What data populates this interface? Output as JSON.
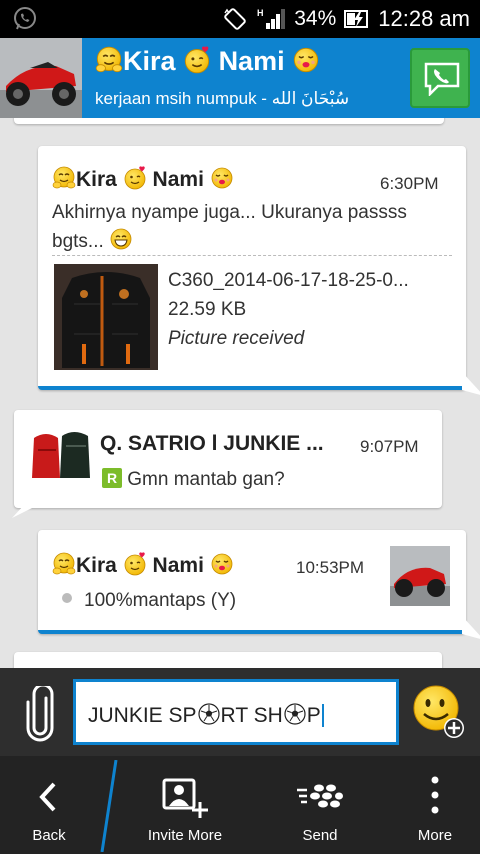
{
  "status_bar": {
    "battery": "34%",
    "time": "12:28 am"
  },
  "header": {
    "title": "Kira",
    "title_name": "Nami",
    "subtitle": "kerjaan msih numpuk  - سُبْحَانَ الله"
  },
  "messages": [
    {
      "sender": "Kira",
      "sender_name": "Nami",
      "time": "6:30PM",
      "text": "Akhirnya nyampe juga... Ukuranya passss bgts...",
      "attachment": {
        "filename": "C360_2014-06-17-18-25-0...",
        "size": "22.59 KB",
        "status": "Picture received"
      }
    },
    {
      "sender": "Q. SATRIO l JUNKIE ...",
      "time": "9:07PM",
      "badge": "R",
      "text": "Gmn mantab gan?"
    },
    {
      "sender": "Kira",
      "sender_name": "Nami",
      "time": "10:53PM",
      "text": "100%mantaps (Y)"
    }
  ],
  "composer": {
    "value_part1": "JUNKIE SP",
    "value_part2": "RT SH",
    "value_part3": "P"
  },
  "bottom_nav": {
    "back": "Back",
    "invite_more": "Invite More",
    "send": "Send",
    "more": "More"
  },
  "colors": {
    "accent": "#0e83cf",
    "call_green": "#3fb34f",
    "nav_bg": "#232323"
  }
}
